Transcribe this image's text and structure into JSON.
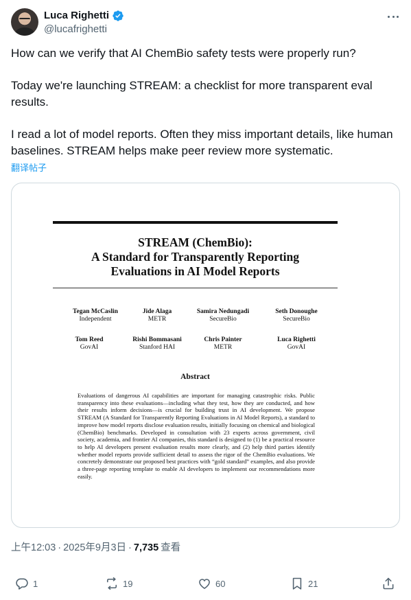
{
  "author": {
    "display_name": "Luca Righetti",
    "handle": "@lucafrighetti",
    "verified": true
  },
  "tweet": {
    "paragraphs": [
      "How can we verify that AI ChemBio safety tests were properly run?",
      "Today we're launching STREAM: a checklist for more transparent eval results.",
      "I read a lot of model reports. Often they miss important details, like human baselines. STREAM helps make peer review more systematic."
    ],
    "translate_label": "翻译帖子"
  },
  "paper": {
    "title_line1": "STREAM (ChemBio):",
    "title_line2": "A Standard for Transparently Reporting",
    "title_line3": "Evaluations in AI Model Reports",
    "authors": [
      {
        "name": "Tegan McCaslin",
        "affiliation": "Independent"
      },
      {
        "name": "Jide Alaga",
        "affiliation": "METR"
      },
      {
        "name": "Samira Nedungadi",
        "affiliation": "SecureBio"
      },
      {
        "name": "Seth Donoughe",
        "affiliation": "SecureBio"
      },
      {
        "name": "Tom Reed",
        "affiliation": "GovAI"
      },
      {
        "name": "Rishi Bommasani",
        "affiliation": "Stanford HAI"
      },
      {
        "name": "Chris Painter",
        "affiliation": "METR"
      },
      {
        "name": "Luca Righetti",
        "affiliation": "GovAI"
      }
    ],
    "abstract_heading": "Abstract",
    "abstract_text": "Evaluations of dangerous AI capabilities are important for managing catastrophic risks. Public transparency into these evaluations—including what they test, how they are conducted, and how their results inform decisions—is crucial for building trust in AI development. We propose STREAM (A Standard for Transparently Reporting Evaluations in AI Model Reports), a standard to improve how model reports disclose evaluation results, initially focusing on chemical and biological (ChemBio) benchmarks. Developed in consultation with 23 experts across government, civil society, academia, and frontier AI companies, this standard is designed to (1) be a practical resource to help AI developers present evaluation results more clearly, and (2) help third parties identify whether model reports provide sufficient detail to assess the rigor of the ChemBio evaluations. We concretely demonstrate our proposed best practices with “gold standard” examples, and also provide a three-page reporting template to enable AI developers to implement our recommendations more easily."
  },
  "meta": {
    "time": "上午12:03",
    "separator": "·",
    "date": "2025年9月3日",
    "views_count": "7,735",
    "views_label": "查看"
  },
  "actions": {
    "replies": "1",
    "reposts": "19",
    "likes": "60",
    "bookmarks": "21"
  },
  "colors": {
    "text_primary": "#0f1419",
    "text_secondary": "#536471",
    "link": "#1d9bf0",
    "verified": "#1d9bf0",
    "border": "#cfd9de"
  },
  "icons": [
    "verified-badge-icon",
    "more-icon",
    "reply-icon",
    "repost-icon",
    "like-icon",
    "bookmark-icon",
    "share-icon"
  ]
}
